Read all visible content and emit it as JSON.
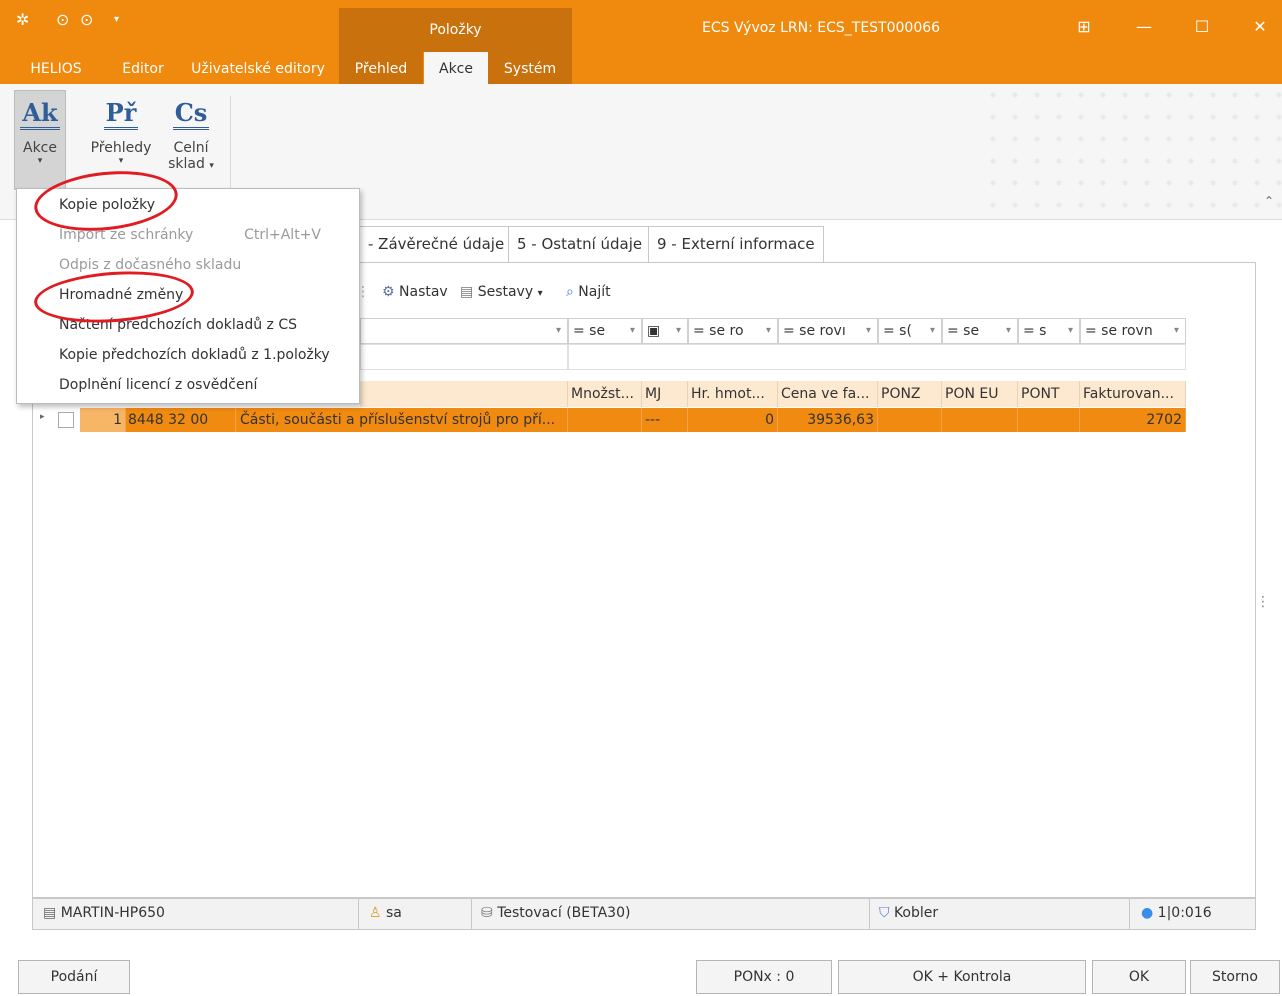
{
  "titlebar": {
    "context_group": "Položky",
    "window_title": "ECS Vývoz  LRN: ECS_TEST000066",
    "bg_color": "#ef8a0f"
  },
  "tabs": [
    {
      "label": "HELIOS"
    },
    {
      "label": "Editor"
    },
    {
      "label": "Uživatelské editory"
    },
    {
      "label": "Přehled"
    },
    {
      "label": "Akce"
    },
    {
      "label": "Systém"
    }
  ],
  "ribbon": {
    "akce": {
      "glyph": "Ak",
      "label": "Akce"
    },
    "prehledy": {
      "glyph": "Př",
      "label": "Přehledy"
    },
    "celni": {
      "glyph": "Cs",
      "label1": "Celní",
      "label2": "sklad"
    }
  },
  "page_tabs": [
    {
      "label": "- Závěrečné údaje"
    },
    {
      "label": "5 - Ostatní údaje"
    },
    {
      "label": "9 - Externí informace"
    }
  ],
  "toolbar": {
    "nastav": "Nastav",
    "sestavy": "Sestavy",
    "najit": "Najít"
  },
  "filters": [
    "= se",
    "= se ro",
    "= se rovı",
    "= s(",
    "= se",
    "= s",
    "= se rovn"
  ],
  "columns": [
    "Množst...",
    "MJ",
    "Hr. hmot...",
    "Cena ve fa...",
    "PONZ",
    "PON EU",
    "PONT",
    "Fakturovan..."
  ],
  "row": {
    "number": "1",
    "code": "8448 32 00",
    "description": "Části, součásti a příslušenství strojů pro pří...",
    "mj": "---",
    "hr_hmot": "0",
    "cena": "39536,63",
    "fakturovano": "2702",
    "highlight_color": "#f08a11"
  },
  "dropdown": {
    "items": [
      {
        "label": "Kopie položky",
        "enabled": true
      },
      {
        "label": "Import ze schránky",
        "enabled": false,
        "shortcut": "Ctrl+Alt+V"
      },
      {
        "label": "Odpis z dočasného skladu",
        "enabled": false
      },
      {
        "label": "Hromadné změny",
        "enabled": true
      },
      {
        "label": "Načtení předchozích dokladů z CS",
        "enabled": true
      },
      {
        "label": "Kopie předchozích dokladů z 1.položky",
        "enabled": true
      },
      {
        "label": "Doplnění licencí z osvědčení",
        "enabled": true
      }
    ],
    "highlight_color": "#e11b22"
  },
  "statusbar": {
    "computer": "MARTIN-HP650",
    "user": "sa",
    "database": "Testovací (BETA30)",
    "filter": "Kobler",
    "counter": "1|0:016"
  },
  "bottom_buttons": {
    "podani": "Podání",
    "ponx": "PONx : 0",
    "ok_kontrola": "OK + Kontrola",
    "ok": "OK",
    "storno": "Storno"
  }
}
